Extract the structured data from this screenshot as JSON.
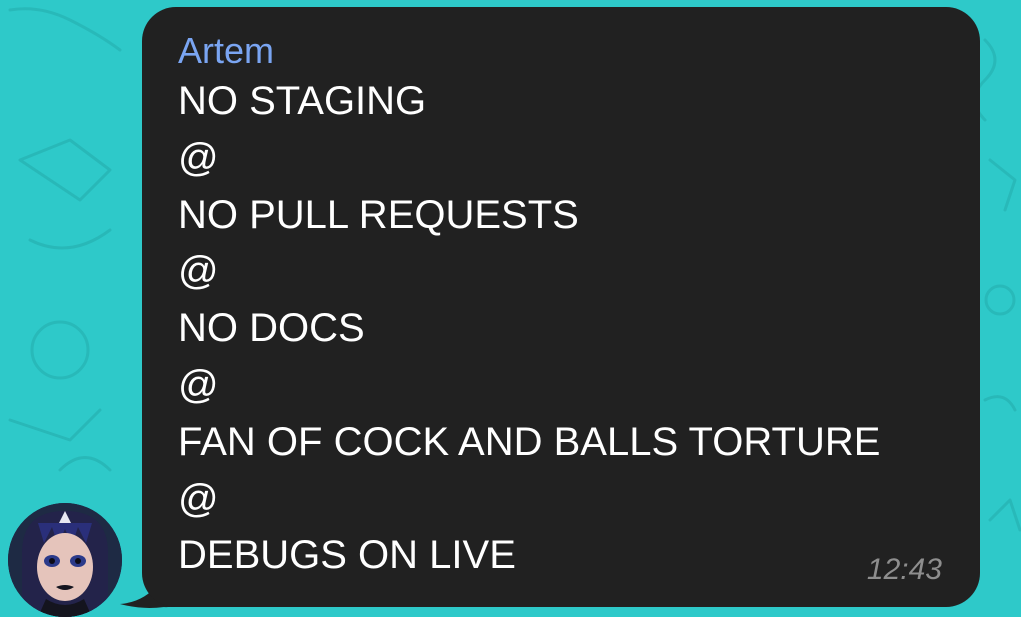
{
  "chat": {
    "background_color": "#2ec9c9",
    "bubble_color": "#212121"
  },
  "message": {
    "sender": "Artem",
    "sender_color": "#7aa5f2",
    "lines": [
      "NO STAGING",
      "@",
      "NO PULL REQUESTS",
      "@",
      "NO DOCS",
      "@",
      "FAN OF COCK AND BALLS TORTURE",
      "@",
      "DEBUGS ON LIVE"
    ],
    "time": "12:43"
  },
  "avatar": {
    "icon": "user-avatar-icon"
  }
}
